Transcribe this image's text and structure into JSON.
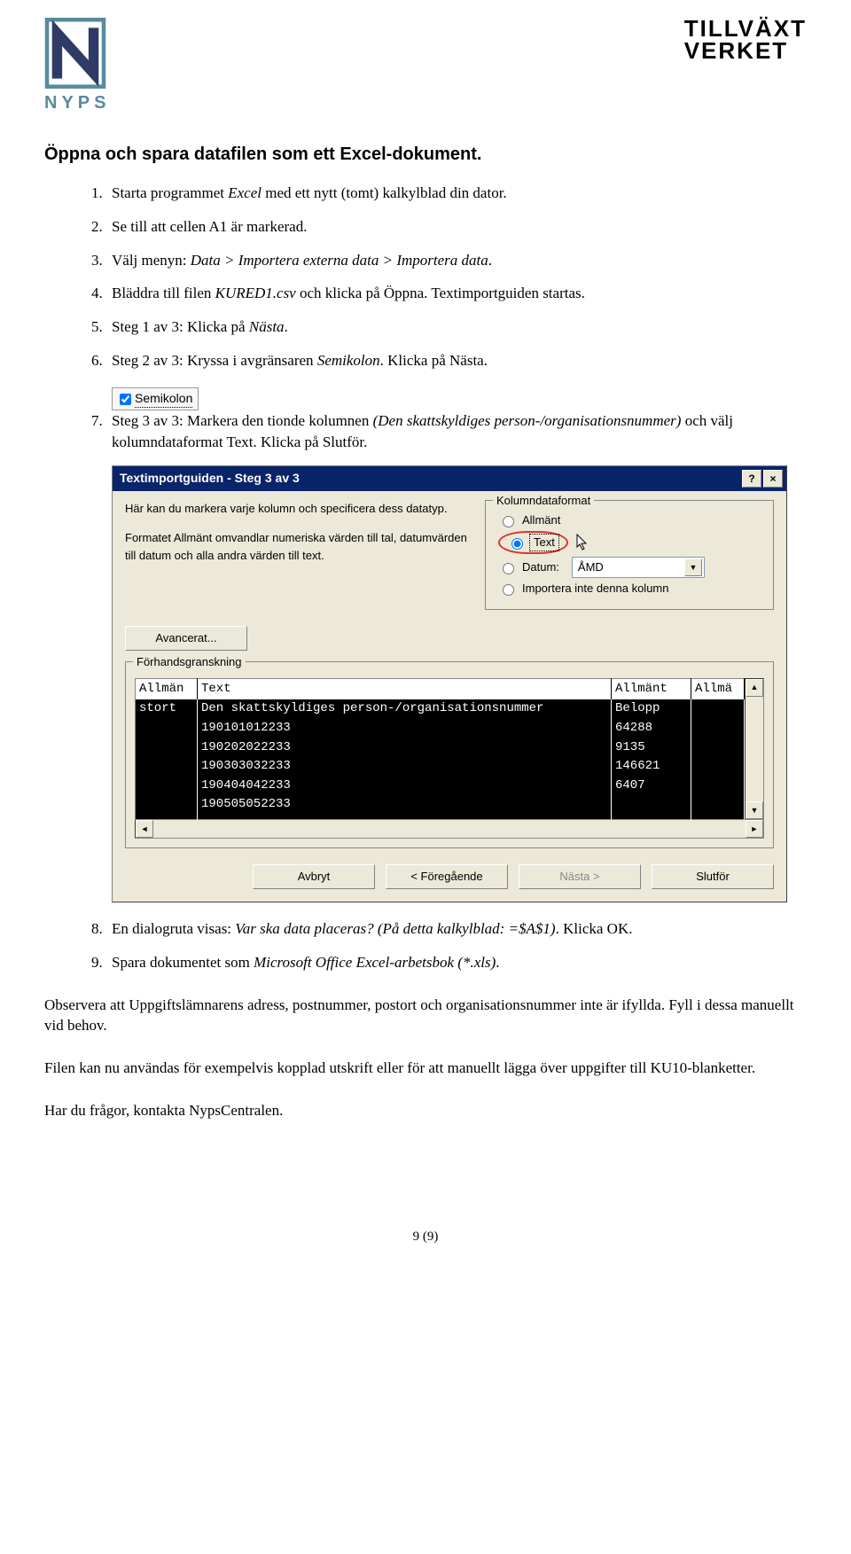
{
  "logo": {
    "left_text": "NYPS",
    "right_line1": "TILLVÄXT",
    "right_line2": "VERKET"
  },
  "section_title": "Öppna och spara datafilen som ett Excel-dokument.",
  "steps": [
    {
      "n": "1",
      "text_before": "Starta programmet ",
      "em": "Excel",
      "text_after": " med ett nytt (tomt) kalkylblad din dator."
    },
    {
      "n": "2",
      "text_before": "Se till att cellen A1 är markerad.",
      "em": "",
      "text_after": ""
    },
    {
      "n": "3",
      "text_before": "Välj menyn: ",
      "em": "Data > Importera externa data > Importera data",
      "text_after": "."
    },
    {
      "n": "4",
      "text_before": "Bläddra till filen ",
      "em": "KURED1.csv",
      "text_after": " och klicka på Öppna. Textimportguiden startas."
    },
    {
      "n": "5",
      "text_before": "Steg 1 av 3: Klicka på ",
      "em": "Nästa",
      "text_after": "."
    },
    {
      "n": "6",
      "text_before": "Steg 2 av 3: Kryssa i avgränsaren ",
      "em": "Semikolon",
      "text_after": ". Klicka på Nästa."
    },
    {
      "n": "7",
      "text_before": "Steg 3 av 3: Markera den tionde kolumnen ",
      "em": "(Den skattskyldiges person-/organisationsnummer)",
      "text_after": " och välj kolumndataformat Text. Klicka på Slutför."
    },
    {
      "n": "8",
      "text_before": "En dialogruta visas: ",
      "em": "Var ska data placeras? (På detta kalkylblad: =$A$1)",
      "text_after": ". Klicka OK."
    },
    {
      "n": "9",
      "text_before": "Spara dokumentet som ",
      "em": "Microsoft Office Excel-arbetsbok (*.xls)",
      "text_after": "."
    }
  ],
  "semikolon_label": "Semikolon",
  "dialog": {
    "title": "Textimportguiden - Steg 3 av 3",
    "desc1": "Här kan du markera varje kolumn och specificera dess datatyp.",
    "desc2": "Formatet Allmänt omvandlar numeriska värden till tal, datumvärden till datum och alla andra värden till text.",
    "group_label": "Kolumndataformat",
    "radio_allmant": "Allmänt",
    "radio_text": "Text",
    "radio_datum_label": "Datum:",
    "radio_datum_value": "ÅMD",
    "radio_skip": "Importera inte denna kolumn",
    "advanced_btn": "Avancerat...",
    "preview_legend": "Förhandsgranskning",
    "headers": [
      "Allmän",
      "Text",
      "Allmänt",
      "Allmä"
    ],
    "row_title": [
      "stort",
      "Den skattskyldiges person-/organisationsnummer",
      "Belopp",
      ""
    ],
    "rows": [
      [
        "",
        "190101012233",
        "64288",
        ""
      ],
      [
        "",
        "190202022233",
        "9135",
        ""
      ],
      [
        "",
        "190303032233",
        "146621",
        ""
      ],
      [
        "",
        "190404042233",
        "6407",
        ""
      ],
      [
        "",
        "190505052233",
        "",
        ""
      ]
    ],
    "btn_cancel": "Avbryt",
    "btn_back": "< Föregående",
    "btn_next": "Nästa >",
    "btn_finish": "Slutför"
  },
  "observe_para": "Observera att Uppgiftslämnarens adress, postnummer, postort och organisationsnummer inte är ifyllda. Fyll i dessa manuellt vid behov.",
  "file_para": "Filen kan nu användas för exempelvis kopplad utskrift eller för att manuellt lägga över uppgifter till KU10-blanketter.",
  "contact_para": "Har du frågor, kontakta NypsCentralen.",
  "page_footer": "9 (9)"
}
